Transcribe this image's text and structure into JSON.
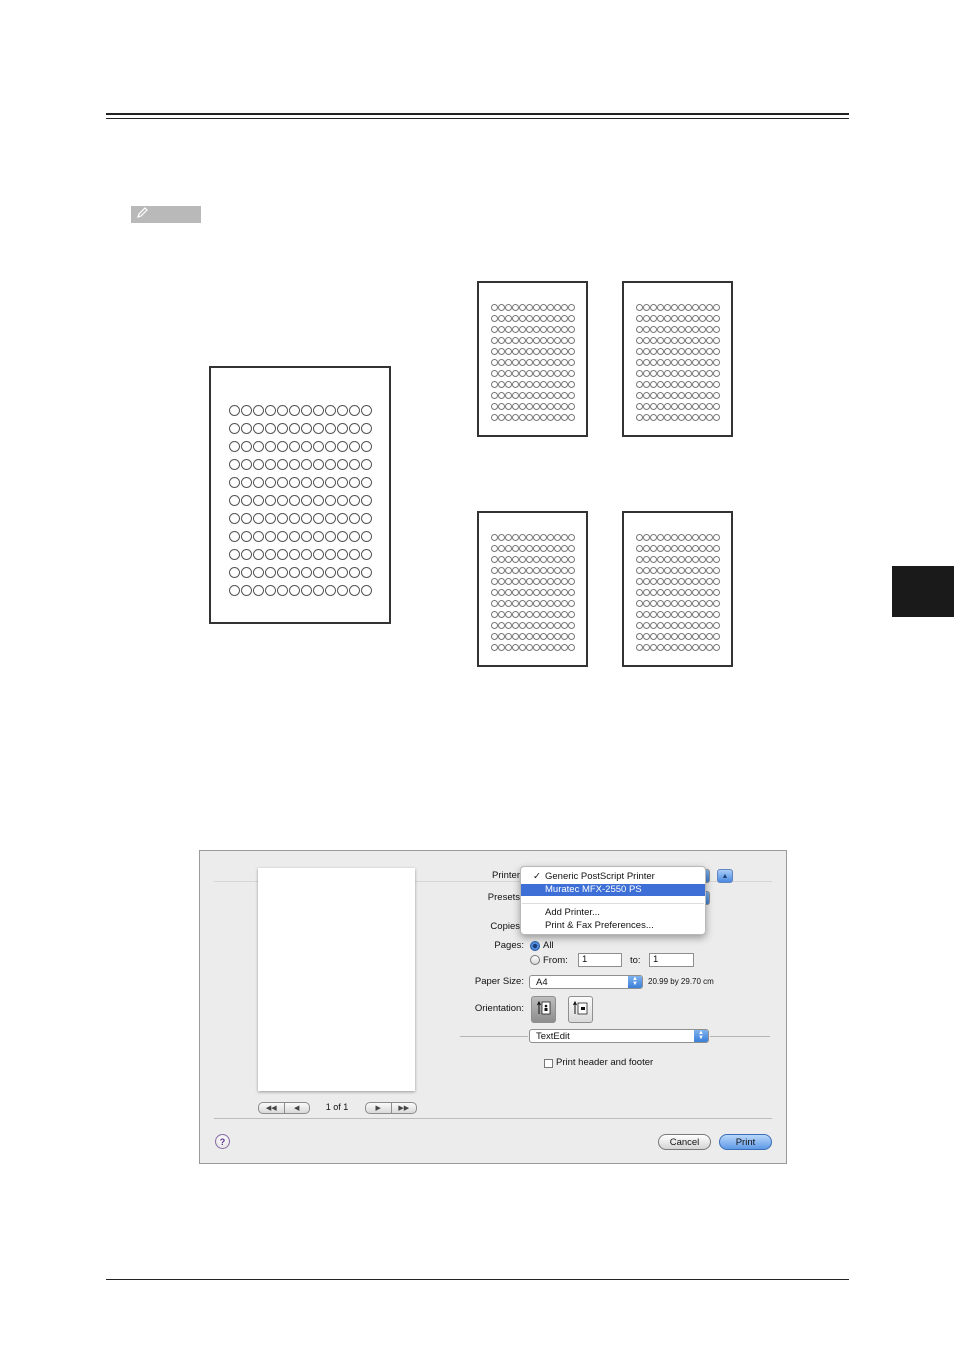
{
  "dialog": {
    "preview": {
      "page_count": "1 of 1",
      "nav_first": "◀◀",
      "nav_prev": "◀",
      "nav_next": "▶",
      "nav_last": "▶▶"
    },
    "printer": {
      "label": "Printer",
      "menu_items": [
        {
          "label": "Generic PostScript Printer",
          "checked": true
        },
        {
          "label": "Muratec MFX-2550 PS",
          "highlighted": true
        },
        {
          "label": "Add Printer..."
        },
        {
          "label": "Print & Fax Preferences..."
        }
      ],
      "check_mark": "✓"
    },
    "presets": {
      "label": "Presets"
    },
    "copies": {
      "label": "Copies"
    },
    "pages": {
      "label": "Pages:",
      "all_label": "All",
      "from_label": "From:",
      "from_value": "1",
      "to_label": "to:",
      "to_value": "1",
      "selected": "All"
    },
    "paper_size": {
      "label": "Paper Size:",
      "value": "A4",
      "dimensions": "20.99 by 29.70 cm"
    },
    "orientation": {
      "label": "Orientation:",
      "selected": "portrait"
    },
    "app_menu": {
      "value": "TextEdit"
    },
    "header_footer": {
      "label": "Print header and footer",
      "checked": false
    },
    "buttons": {
      "help": "?",
      "cancel": "Cancel",
      "print": "Print"
    }
  },
  "colors": {
    "accent": "#3d6fd6",
    "side_tab": "#1a1a1a",
    "note_tag": "#b9b9b9"
  }
}
